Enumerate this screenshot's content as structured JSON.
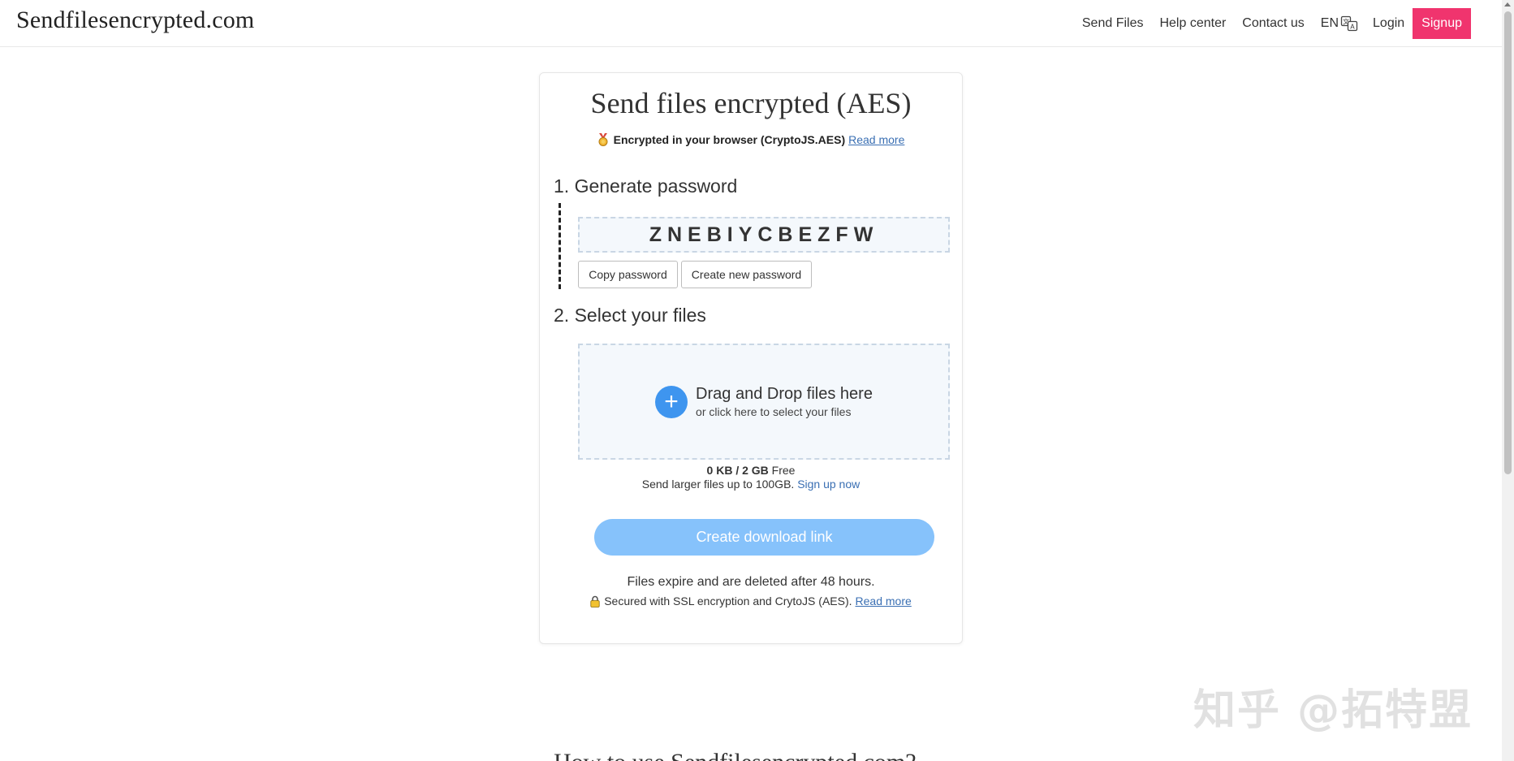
{
  "header": {
    "logo": "Sendfilesencrypted.com",
    "nav": {
      "send_files": "Send Files",
      "help_center": "Help center",
      "contact_us": "Contact us",
      "language": "EN",
      "login": "Login",
      "signup": "Signup"
    },
    "signup_color": "#f0346e"
  },
  "card": {
    "title": "Send files encrypted (AES)",
    "encryption_note": "Encrypted in your browser (CryptoJS.AES)",
    "read_more": "Read more",
    "step1_title": "1. Generate password",
    "password": "ZNEBIYCBEZFW",
    "copy_password": "Copy password",
    "create_new_password": "Create new password",
    "step2_title": "2. Select your files",
    "drop_main": "Drag and Drop files here",
    "drop_sub": "or click here to select your files",
    "quota_used": "0 KB / 2 GB",
    "quota_free": "Free",
    "larger_text": "Send larger files up to 100GB.",
    "sign_up_now": "Sign up now",
    "create_link": "Create download link",
    "expire_text": "Files expire and are deleted after 48 hours.",
    "secured_text": "Secured with SSL encryption and CrytoJS (AES).",
    "secured_read_more": "Read more",
    "accent_color": "#3e95ef",
    "button_color": "#86c2fb"
  },
  "bottom_heading": "How to use Sendfilesencrypted.com?",
  "watermark": "知乎 @拓特盟"
}
